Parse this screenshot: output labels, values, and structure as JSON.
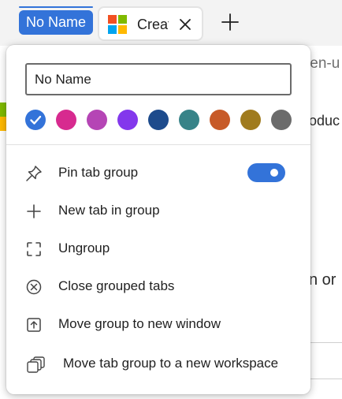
{
  "tab_strip": {
    "group_name": "No Name",
    "tab_title": "Creat",
    "tab_favicon": "windows-logo",
    "group_color": "#3373d9"
  },
  "page": {
    "address_fragment": "/en-u",
    "text_fragment_1": "oduc",
    "text_fragment_2": "n or"
  },
  "popup": {
    "name_value": "No Name",
    "colors": [
      {
        "name": "blue",
        "hex": "#3373d9",
        "selected": true
      },
      {
        "name": "pink",
        "hex": "#d72a8f",
        "selected": false
      },
      {
        "name": "purple",
        "hex": "#b545b5",
        "selected": false
      },
      {
        "name": "violet",
        "hex": "#8338ec",
        "selected": false
      },
      {
        "name": "navy",
        "hex": "#1d4b8c",
        "selected": false
      },
      {
        "name": "teal",
        "hex": "#378388",
        "selected": false
      },
      {
        "name": "orange",
        "hex": "#c75a28",
        "selected": false
      },
      {
        "name": "olive",
        "hex": "#a07b1e",
        "selected": false
      },
      {
        "name": "gray",
        "hex": "#6b6b6b",
        "selected": false
      }
    ],
    "pin_toggle_on": true,
    "items": [
      {
        "label": "Pin tab group",
        "icon": "pin-icon"
      },
      {
        "label": "New tab in group",
        "icon": "plus-icon"
      },
      {
        "label": "Ungroup",
        "icon": "ungroup-icon"
      },
      {
        "label": "Close grouped tabs",
        "icon": "close-circle-icon"
      },
      {
        "label": "Move group to new window",
        "icon": "move-window-icon"
      },
      {
        "label": "Move tab group to a new workspace",
        "icon": "workspace-icon"
      }
    ]
  }
}
